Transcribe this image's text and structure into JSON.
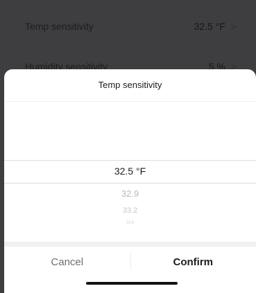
{
  "background": {
    "rows": [
      {
        "label": "Temp sensitivity",
        "value": "32.5 °F",
        "chevron": ">"
      },
      {
        "label": "Humidity sensitivity",
        "value": "5 %",
        "chevron": ">"
      }
    ]
  },
  "sheet": {
    "title": "Temp sensitivity",
    "picker": {
      "selected": "32.5 °F",
      "options_below": [
        "32.9",
        "33.2",
        "33.6"
      ]
    },
    "actions": {
      "cancel_label": "Cancel",
      "confirm_label": "Confirm"
    }
  },
  "colors": {
    "overlay": "#3e3e40",
    "sheet_bg": "#ffffff",
    "text_primary": "#1c1c1e",
    "text_secondary": "#6e6e72"
  }
}
